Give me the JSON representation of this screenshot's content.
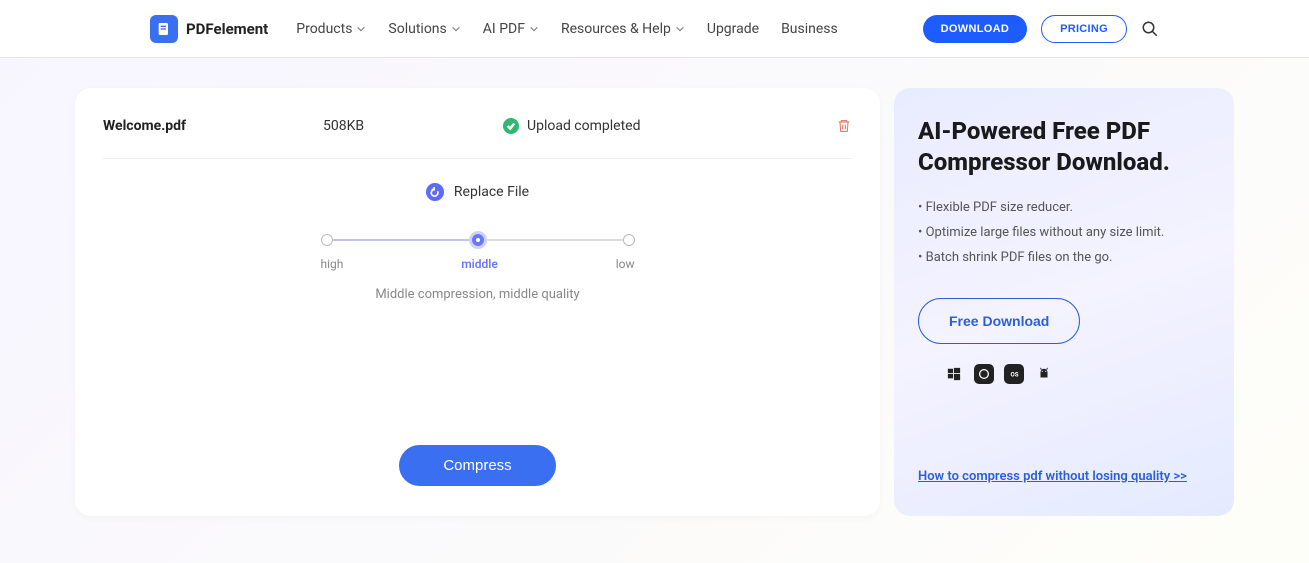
{
  "header": {
    "brand": "PDFelement",
    "nav": {
      "products": "Products",
      "solutions": "Solutions",
      "ai_pdf": "AI PDF",
      "resources": "Resources & Help",
      "upgrade": "Upgrade",
      "business": "Business"
    },
    "download_btn": "DOWNLOAD",
    "pricing_btn": "PRICING"
  },
  "file": {
    "name": "Welcome.pdf",
    "size": "508KB",
    "status": "Upload completed"
  },
  "replace_label": "Replace File",
  "slider": {
    "high": "high",
    "middle": "middle",
    "low": "low",
    "description": "Middle compression, middle quality"
  },
  "compress_btn": "Compress",
  "promo": {
    "title": "AI-Powered Free PDF Compressor Download.",
    "bullet1": "• Flexible PDF size reducer.",
    "bullet2": "• Optimize large files without any size limit.",
    "bullet3": "• Batch shrink PDF files on the go.",
    "free_download": "Free Download",
    "howto": "How to compress pdf without losing quality >>"
  }
}
